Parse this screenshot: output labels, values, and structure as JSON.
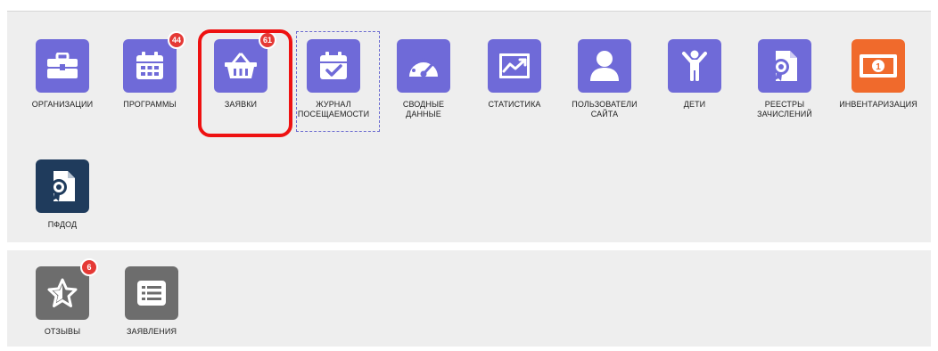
{
  "colors": {
    "purple": "#6f6ad8",
    "orange": "#f06a2c",
    "navy": "#1f3b5c",
    "gray": "#6d6d6d",
    "badge": "#e53935",
    "highlight": "#ee1111"
  },
  "tiles_row1": [
    {
      "label": "ОРГАНИЗАЦИИ",
      "icon": "briefcase-icon"
    },
    {
      "label": "ПРОГРАММЫ",
      "icon": "calendar-icon",
      "badge": "44"
    },
    {
      "label": "ЗАЯВКИ",
      "icon": "basket-icon",
      "badge": "61"
    },
    {
      "label_line1": "ЖУРНАЛ",
      "label_line2": "ПОСЕЩАЕМОСТИ",
      "icon": "calendar-check-icon"
    },
    {
      "label_line1": "СВОДНЫЕ",
      "label_line2": "ДАННЫЕ",
      "icon": "speedometer-icon"
    },
    {
      "label": "СТАТИСТИКА",
      "icon": "chart-icon"
    },
    {
      "label_line1": "ПОЛЬЗОВАТЕЛИ",
      "label_line2": "САЙТА",
      "icon": "user-icon"
    },
    {
      "label": "ДЕТИ",
      "icon": "child-icon"
    },
    {
      "label_line1": "РЕЕСТРЫ",
      "label_line2": "ЗАЧИСЛЕНИЙ",
      "icon": "certificate-icon"
    },
    {
      "label": "ИНВЕНТАРИЗАЦИЯ",
      "icon": "money-icon"
    }
  ],
  "tiles_row2": [
    {
      "label": "ПФДОД",
      "icon": "certificate-icon"
    }
  ],
  "tiles_row3": [
    {
      "label": "ОТЗЫВЫ",
      "icon": "star-icon",
      "badge": "6"
    },
    {
      "label": "ЗАЯВЛЕНИЯ",
      "icon": "list-icon"
    }
  ]
}
